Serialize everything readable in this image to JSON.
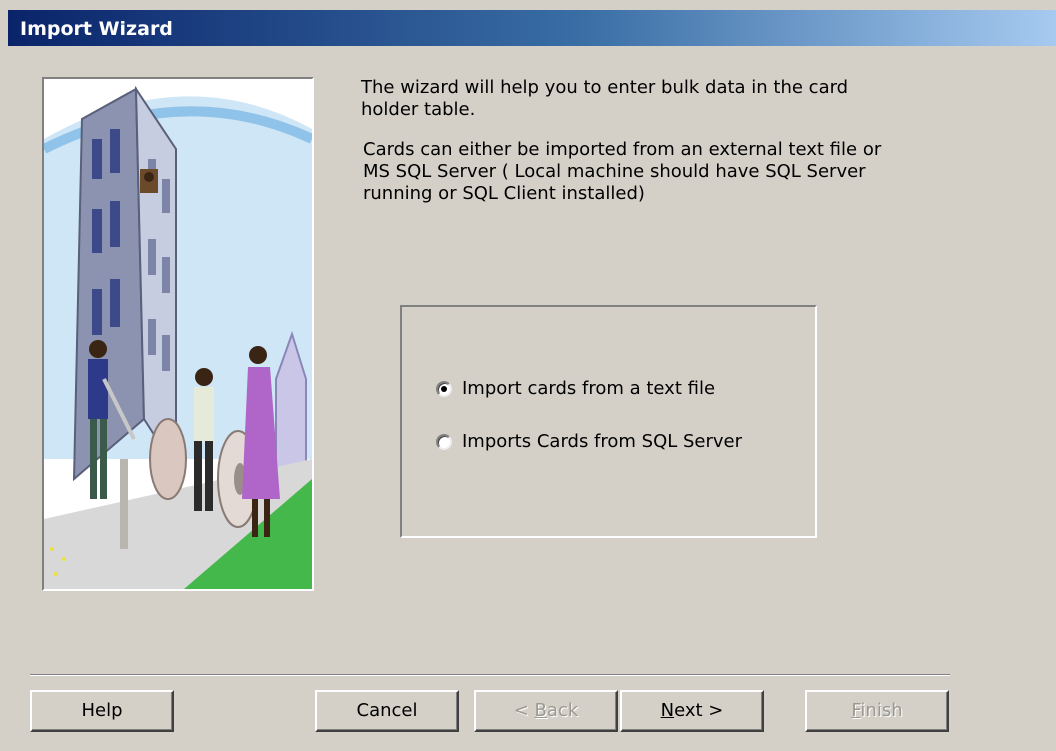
{
  "window": {
    "title": "Import Wizard"
  },
  "intro": {
    "paragraph1": "The wizard will help you to enter bulk data in the card holder table.",
    "paragraph2": "Cards can either be imported from an external text file or MS SQL Server ( Local machine should have SQL Server running or SQL Client installed)"
  },
  "options": [
    {
      "label": "Import cards from a text file",
      "selected": true
    },
    {
      "label": "Imports Cards from SQL Server",
      "selected": false
    }
  ],
  "buttons": {
    "help": "Help",
    "cancel": "Cancel",
    "back_prefix": "< ",
    "back_mnemonic": "B",
    "back_rest": "ack",
    "next_mnemonic": "N",
    "next_rest": "ext >",
    "finish_mnemonic": "F",
    "finish_rest": "inish"
  },
  "colors": {
    "window_bg": "#d4d0c8",
    "titlebar_start": "#0a246a",
    "titlebar_end": "#a6caf0"
  }
}
